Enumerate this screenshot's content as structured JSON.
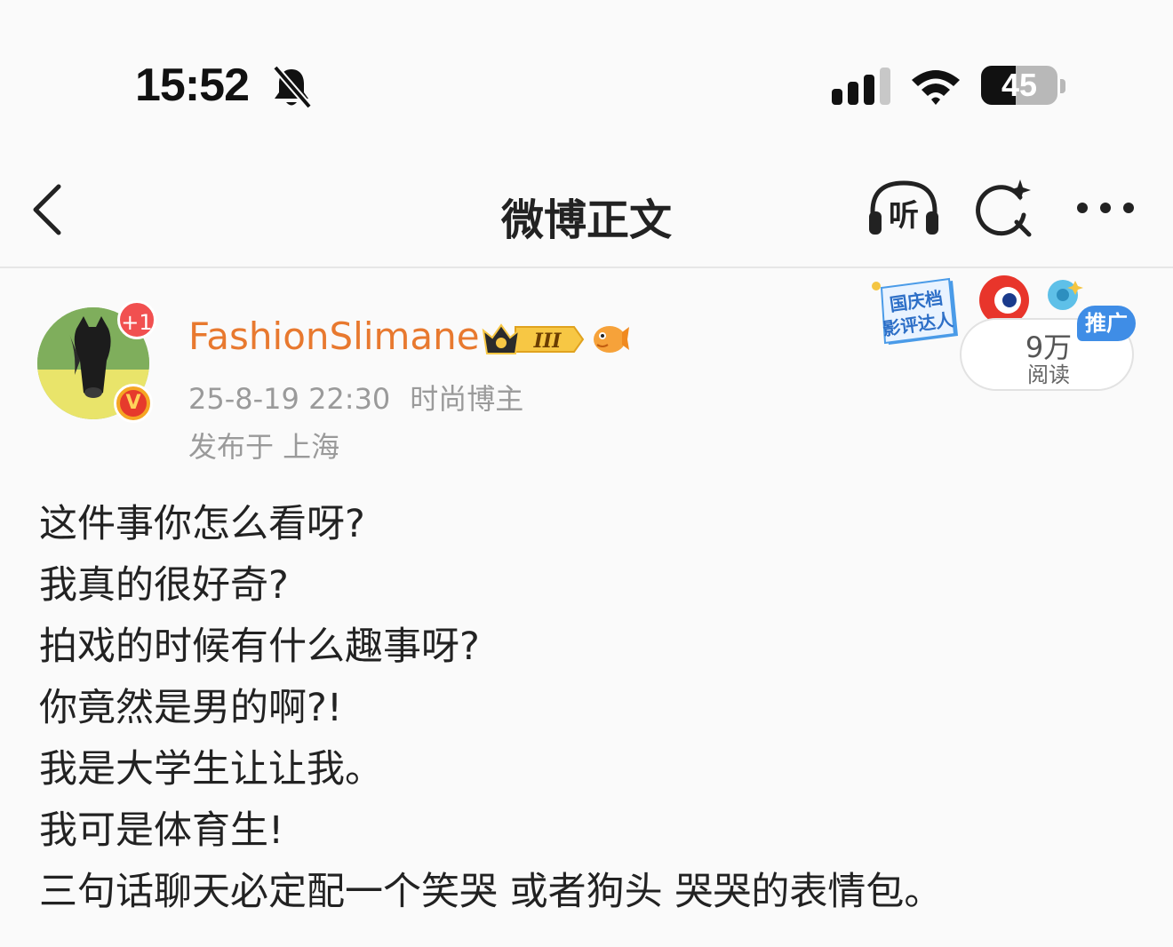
{
  "status_bar": {
    "time": "15:52",
    "battery": "45",
    "battery_fraction": 0.45,
    "icons": [
      "bell-slash-icon",
      "cellular-signal-icon",
      "wifi-icon",
      "battery-icon"
    ]
  },
  "nav": {
    "title": "微博正文",
    "listen_label": "听",
    "icons": [
      "back-chevron-icon",
      "listen-headphones-icon",
      "ai-search-icon",
      "more-dots-icon"
    ]
  },
  "post": {
    "avatar_badge": "+1",
    "verify_mark": "V",
    "username": "FashionSlimane",
    "member_level": "III",
    "timestamp": "25-8-19 22:30",
    "user_tag": "时尚博主",
    "location": "发布于 上海",
    "lines": [
      "这件事你怎么看呀?",
      "我真的很好奇?",
      "拍戏的时候有什么趣事呀?",
      "你竟然是男的啊?!",
      "我是大学生让让我。",
      "我可是体育生!",
      "三句话聊天必定配一个笑哭 或者狗头 哭哭的表情包。"
    ]
  },
  "promo": {
    "art_text_1": "国庆档",
    "art_text_2": "影评达人",
    "reads_count": "9万",
    "reads_label": "阅读",
    "ad_tag": "推广"
  },
  "colors": {
    "username": "#e8792f",
    "meta": "#9a9a9a",
    "ad_tag": "#3f8de6",
    "badge_red": "#f15050"
  }
}
